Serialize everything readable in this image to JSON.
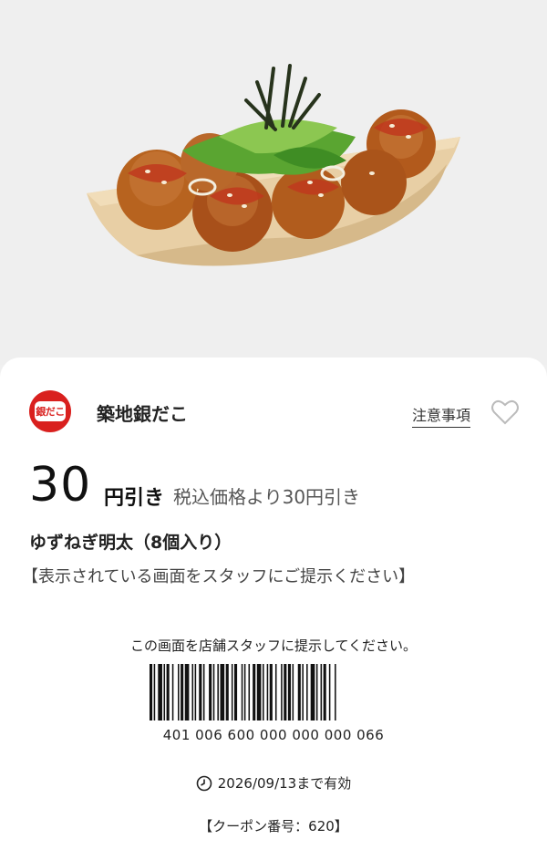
{
  "hero": {
    "image": "takoyaki-with-green-onion-and-seaweed-in-wooden-boat"
  },
  "brand": {
    "logo_text": "銀だこ",
    "name": "築地銀だこ",
    "notice_link": "注意事項",
    "favorite_icon": "heart-outline-icon"
  },
  "discount": {
    "amount": "30",
    "unit": "円引き",
    "description": "税込価格より30円引き"
  },
  "product": "ゆずねぎ明太（8個入り）",
  "instruction": "【表示されている画面をスタッフにご提示ください】",
  "barcode": {
    "caption": "この画面を店舗スタッフに提示してください。",
    "number": "401 006 600 000 000 000 066"
  },
  "expiry": {
    "icon": "clock-icon",
    "text": "2026/09/13まで有効"
  },
  "coupon_number": "【クーポン番号：620】",
  "colors": {
    "brand_red": "#d9201e",
    "card_bg": "#ffffff",
    "hero_bg": "#efefef"
  }
}
